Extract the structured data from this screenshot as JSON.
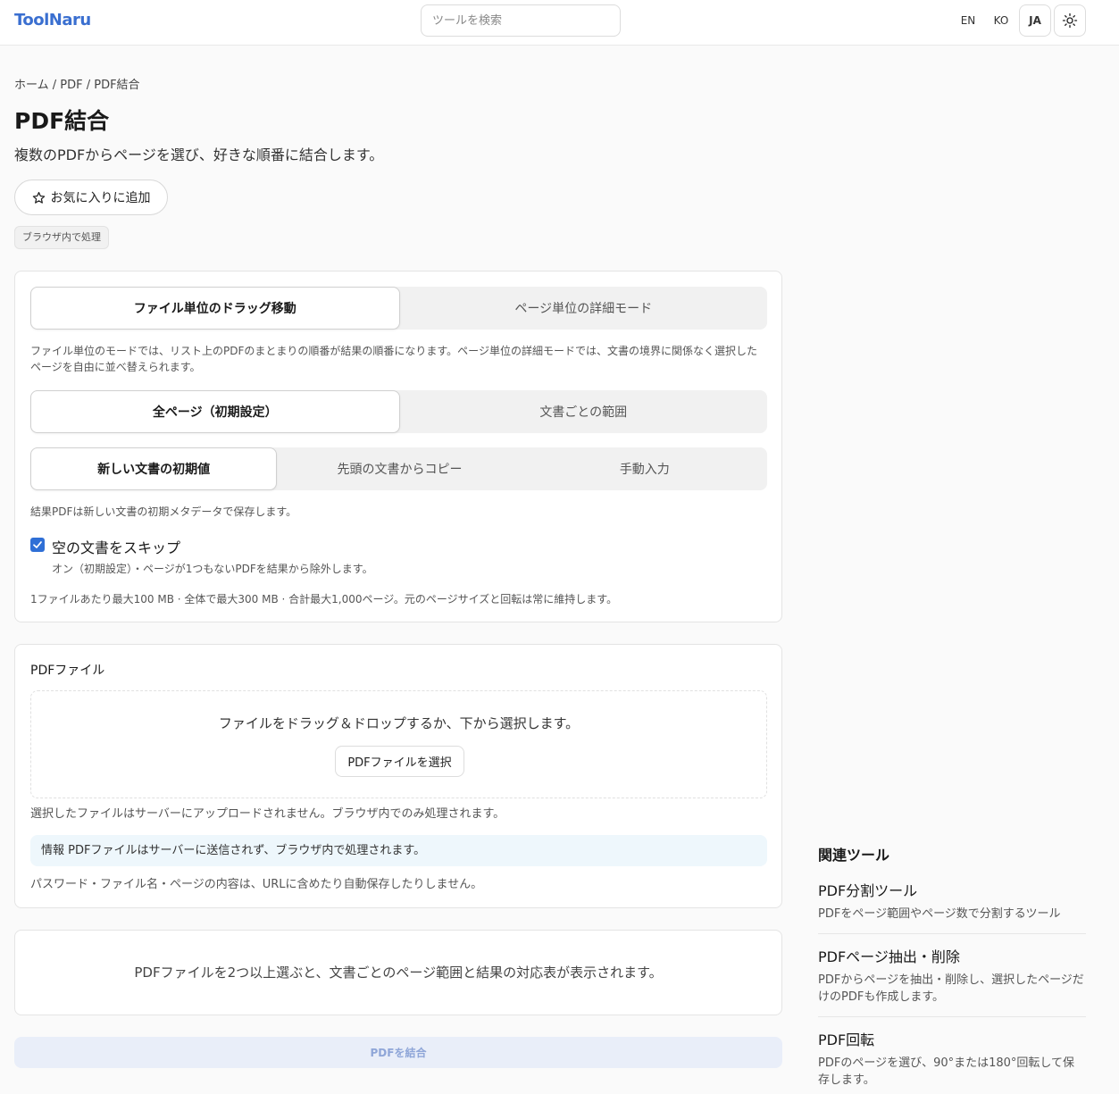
{
  "header": {
    "logo": "ToolNaru",
    "search_placeholder": "ツールを検索",
    "langs": [
      "EN",
      "KO",
      "JA"
    ],
    "active_lang": "JA",
    "theme_icon": "sun-icon"
  },
  "breadcrumb": "ホーム / PDF / PDF結合",
  "page": {
    "title": "PDF結合",
    "subtitle": "複数のPDFからページを選び、好きな順番に結合します。",
    "favorite_label": "お気に入りに追加",
    "badge": "ブラウザ内で処理"
  },
  "options": {
    "mode_tabs": [
      "ファイル単位のドラッグ移動",
      "ページ単位の詳細モード"
    ],
    "mode_note": "ファイル単位のモードでは、リスト上のPDFのまとまりの順番が結果の順番になります。ページ単位の詳細モードでは、文書の境界に関係なく選択したページを自由に並べ替えられます。",
    "range_tabs": [
      "全ページ（初期設定）",
      "文書ごとの範囲"
    ],
    "meta_tabs": [
      "新しい文書の初期値",
      "先頭の文書からコピー",
      "手動入力"
    ],
    "meta_note": "結果PDFは新しい文書の初期メタデータで保存します。",
    "skip_label": "空の文書をスキップ",
    "skip_desc": "オン（初期設定）・ページが1つもないPDFを結果から除外します。",
    "limits_note": "1ファイルあたり最大100 MB · 全体で最大300 MB · 合計最大1,000ページ。元のページサイズと回転は常に維持します。"
  },
  "files": {
    "title": "PDFファイル",
    "drop_text": "ファイルをドラッグ＆ドロップするか、下から選択します。",
    "select_label": "PDFファイルを選択",
    "upload_note": "選択したファイルはサーバーにアップロードされません。ブラウザ内でのみ処理されます。",
    "info_text": "情報 PDFファイルはサーバーに送信されず、ブラウザ内で処理されます。",
    "privacy_note": "パスワード・ファイル名・ページの内容は、URLに含めたり自動保存したりしません。"
  },
  "mapping": {
    "empty_text": "PDFファイルを2つ以上選ぶと、文書ごとのページ範囲と結果の対応表が表示されます。"
  },
  "merge_label": "PDFを結合",
  "related": {
    "title": "関連ツール",
    "items": [
      {
        "name": "PDF分割ツール",
        "desc": "PDFをページ範囲やページ数で分割するツール"
      },
      {
        "name": "PDFページ抽出・削除",
        "desc": "PDFからページを抽出・削除し、選択したページだけのPDFも作成します。"
      },
      {
        "name": "PDF回転",
        "desc": "PDFのページを選び、90°または180°回転して保存します。"
      }
    ]
  },
  "colors": {
    "accent": "#3a6fd0",
    "checkbox": "#2f6fd6",
    "info_bg": "#eef7fc"
  }
}
